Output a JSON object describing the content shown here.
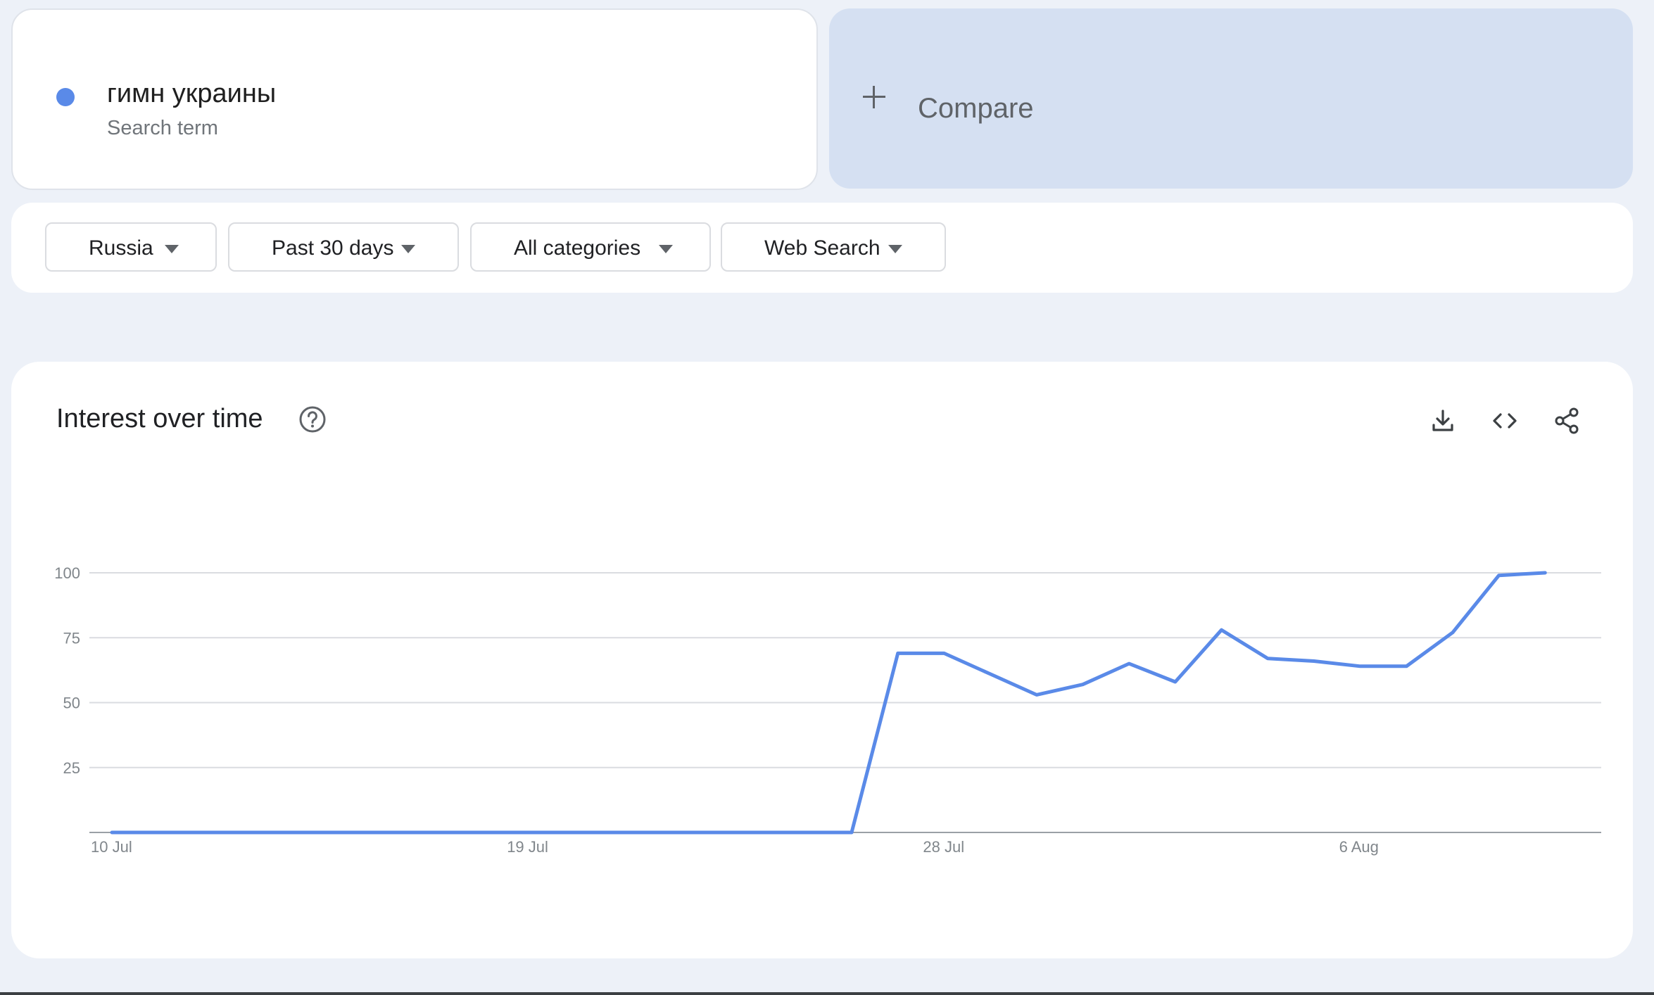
{
  "search_term": {
    "label": "гимн украины",
    "sublabel": "Search term",
    "color": "#5a8ae8"
  },
  "compare": {
    "label": "Compare",
    "background": "#d5e0f2"
  },
  "filters": {
    "region": "Russia",
    "time_range": "Past 30 days",
    "category": "All categories",
    "property": "Web Search"
  },
  "chart_section": {
    "title": "Interest over time",
    "icons": [
      "help-icon",
      "download-icon",
      "embed-icon",
      "share-icon"
    ]
  },
  "chart_data": {
    "type": "line",
    "title": "Interest over time",
    "x": [
      "10 Jul",
      "11 Jul",
      "12 Jul",
      "13 Jul",
      "14 Jul",
      "15 Jul",
      "16 Jul",
      "17 Jul",
      "18 Jul",
      "19 Jul",
      "20 Jul",
      "21 Jul",
      "22 Jul",
      "23 Jul",
      "24 Jul",
      "25 Jul",
      "26 Jul",
      "27 Jul",
      "28 Jul",
      "29 Jul",
      "30 Jul",
      "31 Jul",
      "1 Aug",
      "2 Aug",
      "3 Aug",
      "4 Aug",
      "5 Aug",
      "6 Aug",
      "7 Aug",
      "8 Aug",
      "9 Aug",
      "10 Aug",
      "11 Aug"
    ],
    "series": [
      {
        "values": [
          0,
          0,
          0,
          0,
          0,
          0,
          0,
          0,
          0,
          0,
          0,
          0,
          0,
          0,
          0,
          0,
          0,
          69,
          69,
          61,
          53,
          57,
          65,
          58,
          78,
          67,
          66,
          64,
          64,
          77,
          99,
          100,
          null
        ],
        "color": "#5a8ae8"
      }
    ],
    "x_tick_labels": [
      "10 Jul",
      "19 Jul",
      "28 Jul",
      "6 Aug"
    ],
    "y_ticks": [
      25,
      50,
      75,
      100
    ],
    "ylim": [
      0,
      100
    ],
    "grid": true,
    "legend": "none"
  }
}
